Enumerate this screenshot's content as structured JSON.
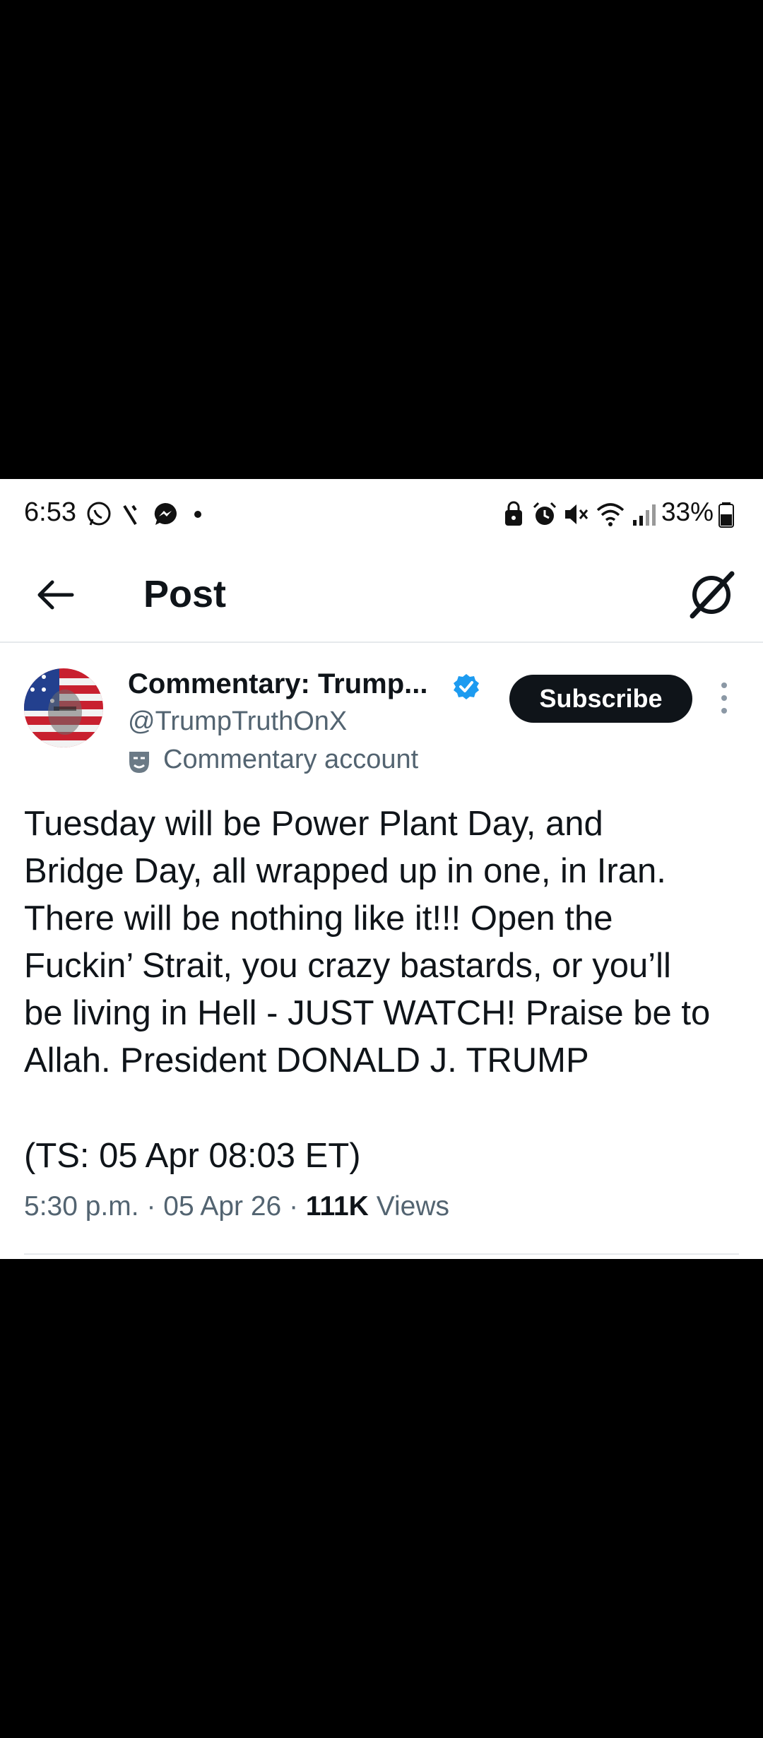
{
  "status_bar": {
    "time": "6:53",
    "battery": "33%",
    "left_icons": [
      "whatsapp-icon",
      "tool-icon",
      "messenger-icon",
      "dot-icon"
    ],
    "right_icons": [
      "lock-icon",
      "alarm-icon",
      "mute-icon",
      "wifi-icon",
      "signal-icon",
      "battery-icon"
    ]
  },
  "header": {
    "title": "Post"
  },
  "post": {
    "author": {
      "display_name": "Commentary: Trump...",
      "handle": "@TrumpTruthOnX",
      "account_label": "Commentary account"
    },
    "subscribe_label": "Subscribe",
    "text": "Tuesday will be Power Plant Day, and\nBridge Day, all wrapped up in one, in Iran.\nThere will be nothing like it!!! Open the\nFuckin’ Strait, you crazy bastards, or you’ll\nbe living in Hell - JUST WATCH! Praise be to\nAllah. President DONALD J. TRUMP",
    "timestamp_note": "(TS: 05 Apr 08:03 ET)",
    "meta": {
      "time": "5:30 p.m.",
      "date": "05 Apr 26",
      "views_count": "111K",
      "views_label": "Views"
    }
  },
  "colors": {
    "text_primary": "#0f1419",
    "text_secondary": "#536471",
    "verified_blue": "#1d9bf0",
    "button_bg": "#0f1419"
  }
}
